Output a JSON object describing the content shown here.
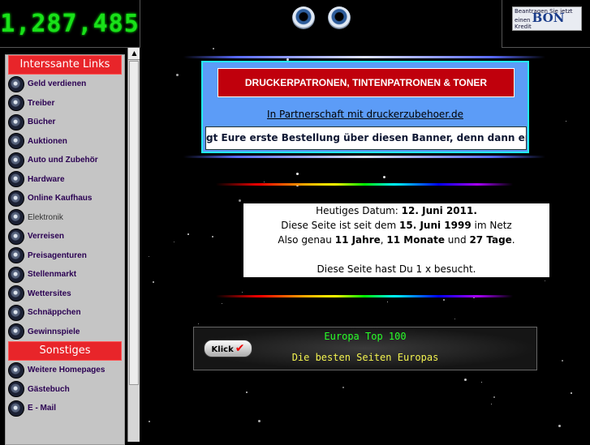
{
  "counter": {
    "value": "1,287,485"
  },
  "ad": {
    "line1": "Beantragen Sie jetzt",
    "line2": "einen",
    "brand": "BON",
    "line3": "Kredit"
  },
  "nav": {
    "section1": "Interssante Links",
    "items1": [
      {
        "label": "Geld verdienen"
      },
      {
        "label": "Treiber"
      },
      {
        "label": "Bücher"
      },
      {
        "label": "Auktionen"
      },
      {
        "label": "Auto und Zubehör"
      },
      {
        "label": "Hardware"
      },
      {
        "label": "Online Kaufhaus"
      },
      {
        "label": "Elektronik"
      },
      {
        "label": "Verreisen"
      },
      {
        "label": "Preisagenturen"
      },
      {
        "label": "Stellenmarkt"
      },
      {
        "label": "Wettersites"
      },
      {
        "label": "Schnäppchen"
      },
      {
        "label": "Gewinnspiele"
      }
    ],
    "section2": "Sonstiges",
    "items2": [
      {
        "label": "Weitere Homepages"
      },
      {
        "label": "Gästebuch"
      },
      {
        "label": "E - Mail"
      }
    ]
  },
  "banner": {
    "title": "DRUCKERPATRONEN, TINTENPATRONEN & TONER",
    "link": "In Partnerschaft mit druckerzubehoer.de",
    "ticker": "gt Eure erste Bestellung über diesen Banner, denn dann er"
  },
  "info": {
    "date_prefix": "Heutiges Datum: ",
    "date": "12. Juni 2011.",
    "since_prefix": "Diese Seite ist seit dem ",
    "since_date": "15. Juni 1999",
    "since_suffix": " im Netz",
    "age_prefix": "Also genau ",
    "years": "11 Jahre",
    "sep1": ", ",
    "months": "11 Monate",
    "sep2": " und ",
    "days": "27 Tage",
    "age_suffix": ".",
    "visits": "Diese Seite hast Du 1 x besucht."
  },
  "top100": {
    "button": "Klick",
    "title": "Europa Top 100",
    "subtitle": "Die besten Seiten Europas"
  }
}
